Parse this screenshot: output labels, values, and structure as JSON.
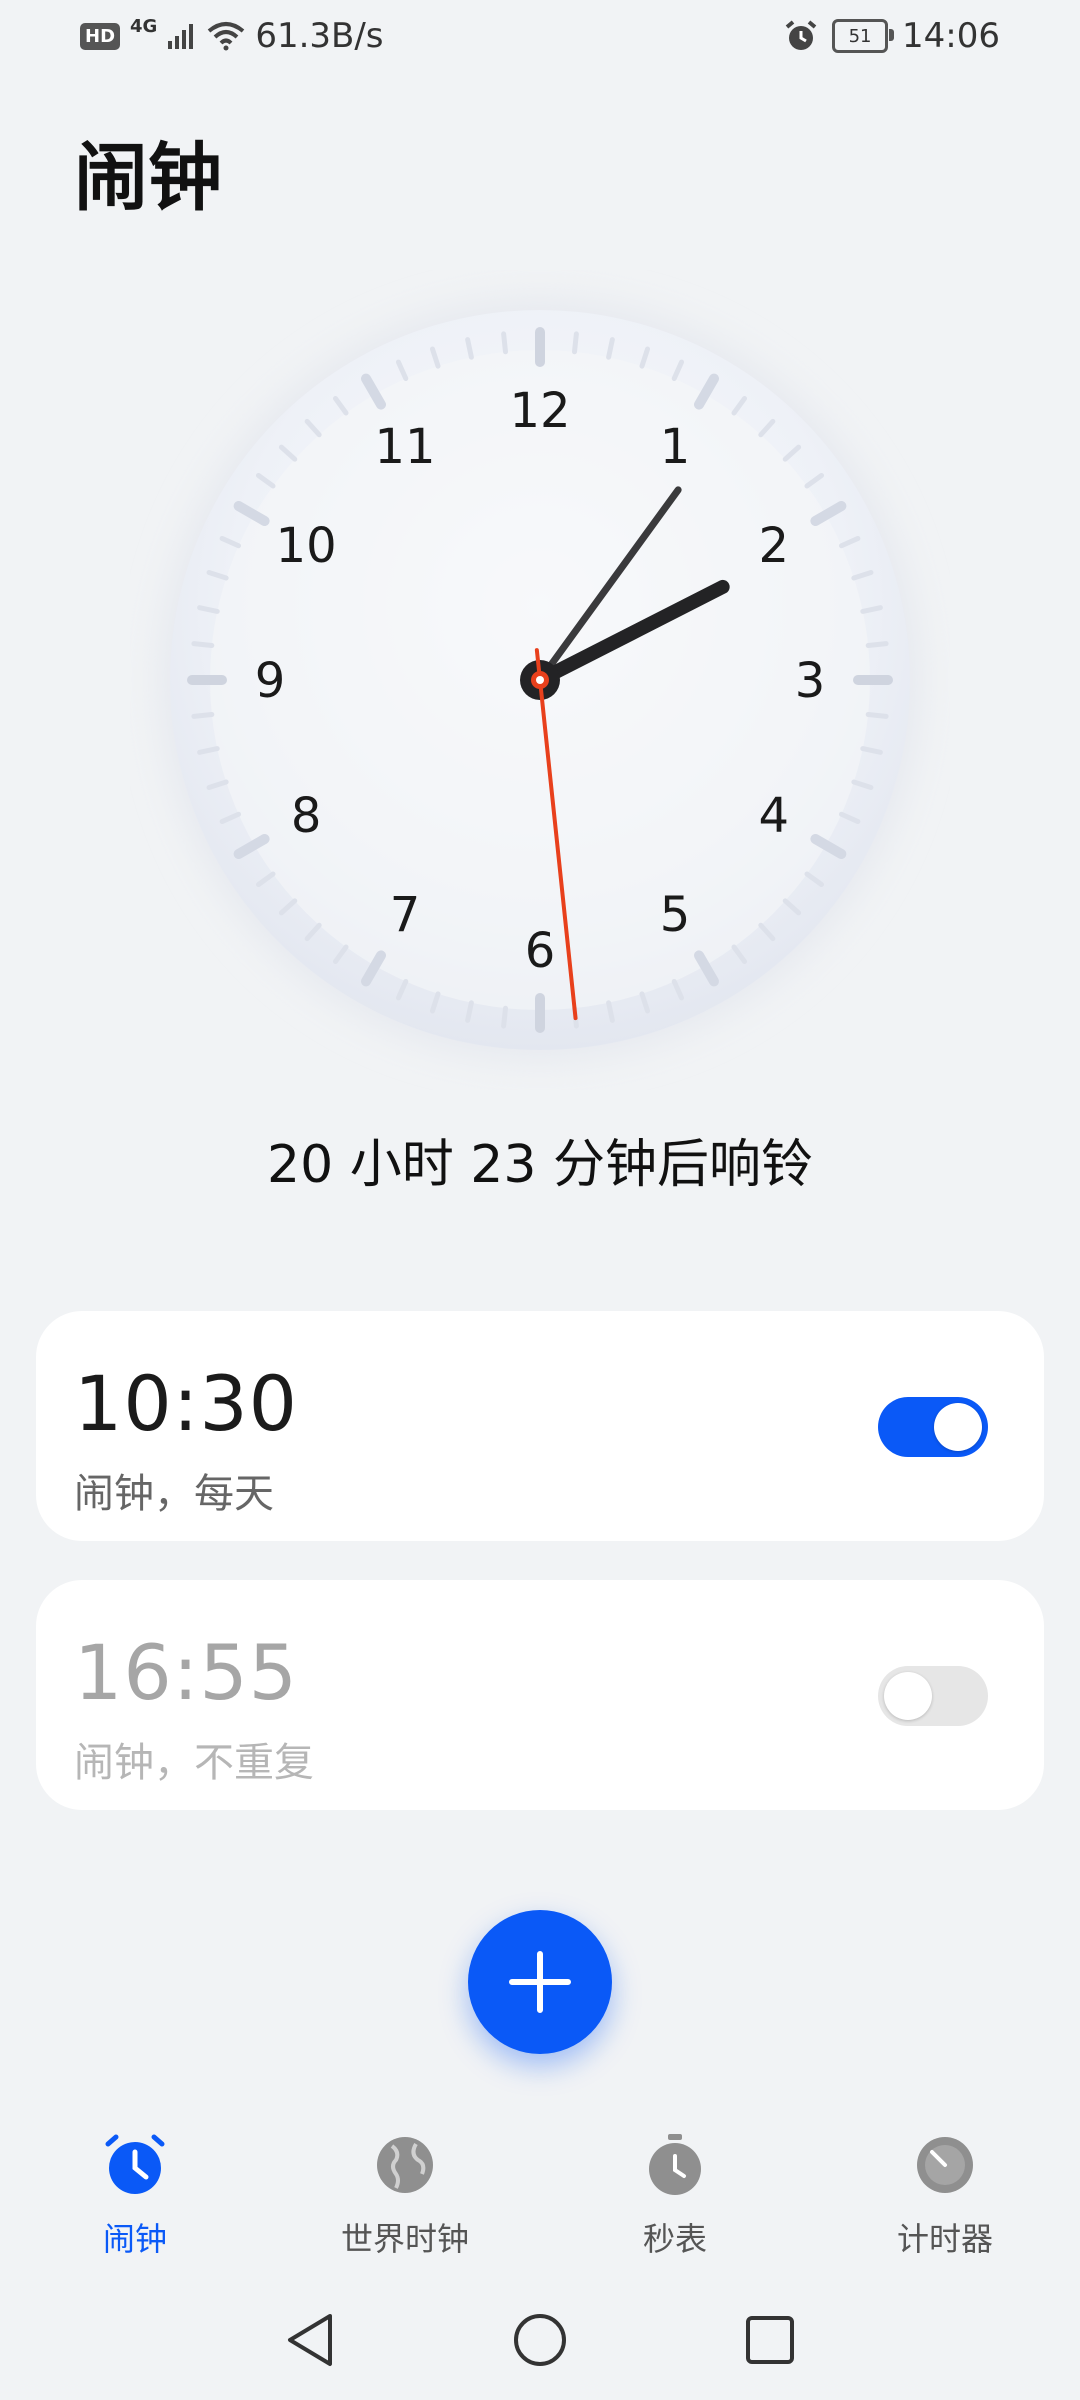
{
  "status_bar": {
    "hd": "HD",
    "network": "4G",
    "speed": "61.3B/s",
    "battery": "51",
    "time": "14:06"
  },
  "page_title": "闹钟",
  "clock": {
    "numbers": [
      "12",
      "1",
      "2",
      "3",
      "4",
      "5",
      "6",
      "7",
      "8",
      "9",
      "10",
      "11"
    ],
    "hour_angle_deg": 63,
    "minute_angle_deg": 36,
    "second_angle_deg": 174
  },
  "countdown": "20 小时 23 分钟后响铃",
  "alarms": [
    {
      "time": "10:30",
      "label": "闹钟，每天",
      "enabled": true
    },
    {
      "time": "16:55",
      "label": "闹钟，不重复",
      "enabled": false
    }
  ],
  "fab_icon": "plus-icon",
  "nav": [
    {
      "label": "闹钟",
      "icon": "alarm-clock-icon",
      "active": true
    },
    {
      "label": "世界时钟",
      "icon": "globe-icon",
      "active": false
    },
    {
      "label": "秒表",
      "icon": "stopwatch-icon",
      "active": false
    },
    {
      "label": "计时器",
      "icon": "timer-icon",
      "active": false
    }
  ],
  "colors": {
    "accent": "#0a59f7",
    "second_hand": "#e8401c"
  }
}
